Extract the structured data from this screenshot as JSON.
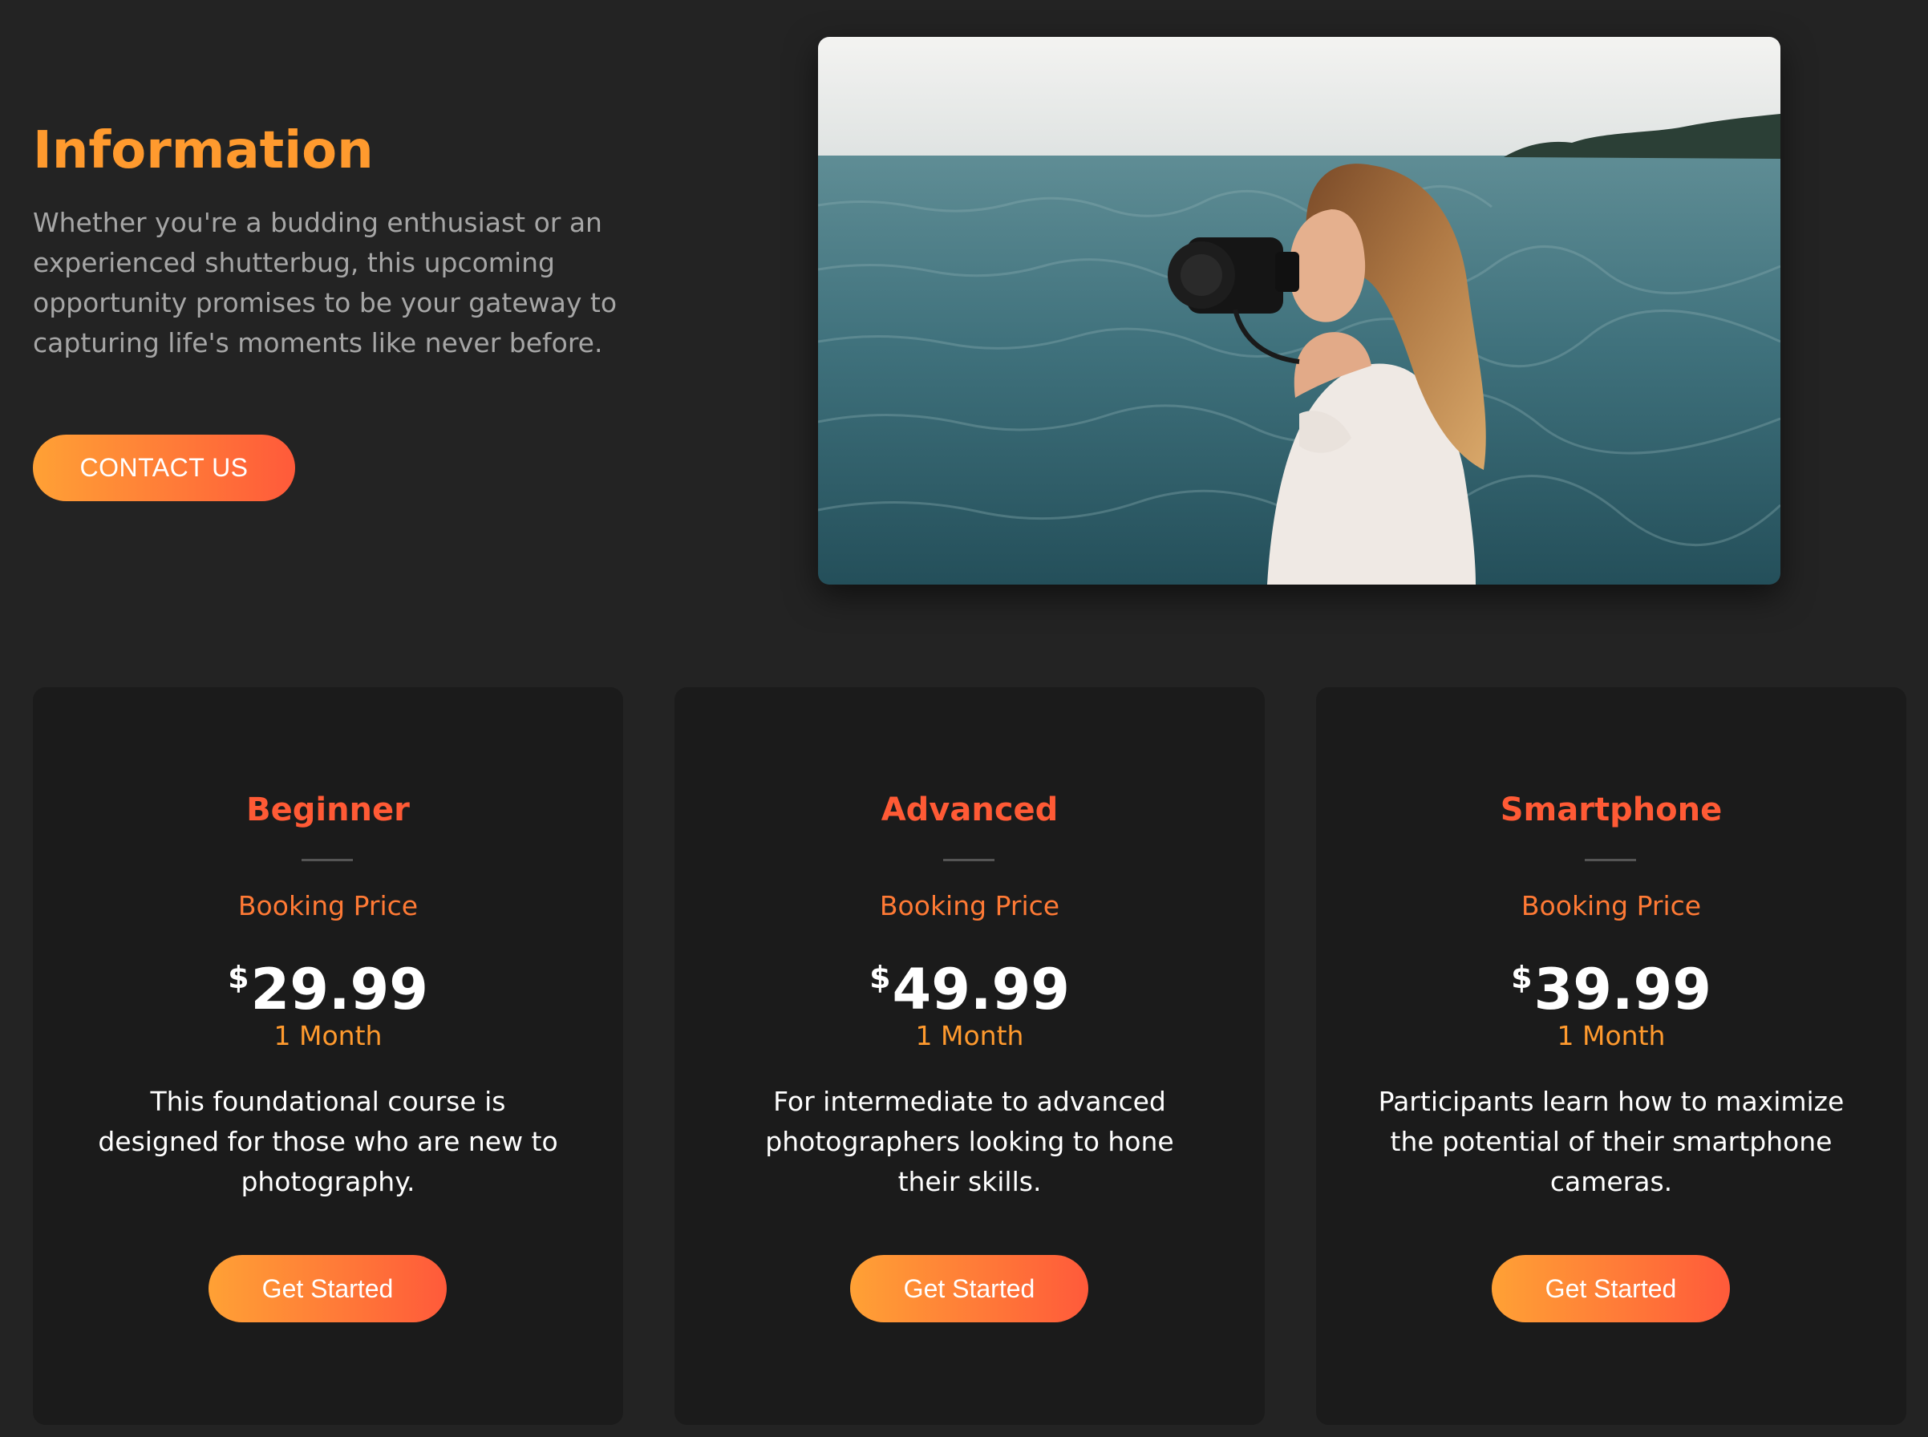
{
  "info": {
    "title": "Information",
    "text": "Whether you're a budding enthusiast or an experienced shutterbug, this upcoming opportunity promises to be your gateway to capturing life's moments like never before.",
    "contact_label": "CONTACT US"
  },
  "colors": {
    "background": "#232323",
    "card": "#1b1b1b",
    "accent_orange": "#ff9a2e",
    "accent_red": "#ff5a35",
    "gradient_start": "#ffa135",
    "gradient_end": "#ff5a3a"
  },
  "plans": [
    {
      "name": "Beginner",
      "subtitle": "Booking Price",
      "currency": "$",
      "price": "29.99",
      "period": "1 Month",
      "description": "This foundational course is designed for those who are new to photography.",
      "cta": "Get Started"
    },
    {
      "name": "Advanced",
      "subtitle": "Booking Price",
      "currency": "$",
      "price": "49.99",
      "period": "1 Month",
      "description": "For intermediate to advanced photographers looking to hone their skills.",
      "cta": "Get Started"
    },
    {
      "name": "Smartphone",
      "subtitle": "Booking Price",
      "currency": "$",
      "price": "39.99",
      "period": "1 Month",
      "description": "Participants learn how to maximize the potential of their smartphone cameras.",
      "cta": "Get Started"
    }
  ]
}
